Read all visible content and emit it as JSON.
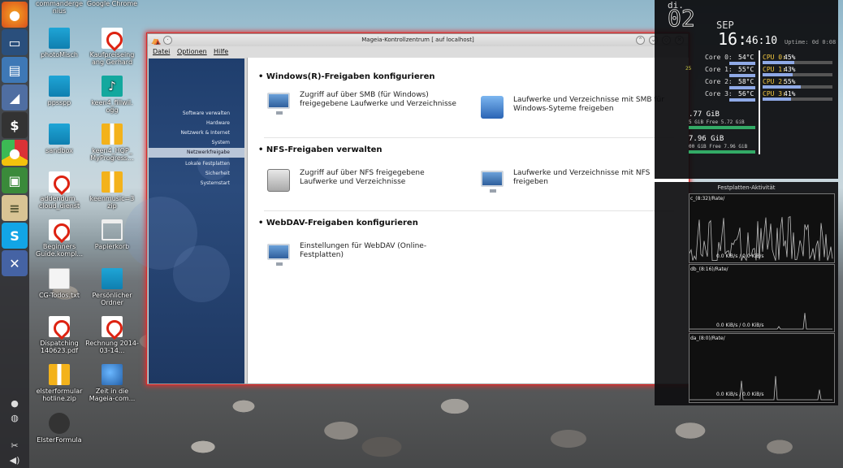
{
  "desktop_icons": [
    {
      "label": "commanderge nius"
    },
    {
      "label": "Google Chrome"
    },
    {
      "label": "photoMisch"
    },
    {
      "label": "Kaufpreiseing ang Gerhard"
    },
    {
      "label": "ppsspp"
    },
    {
      "label": "keen4_fillwil. ogg"
    },
    {
      "label": "sandbox"
    },
    {
      "label": "keen4_HQP_ MyProgress..."
    },
    {
      "label": "addendum_ cloud_dienst"
    },
    {
      "label": "keenmusic=3 zip"
    },
    {
      "label": "Beginners Guide.kompl..."
    },
    {
      "label": "Papierkorb"
    },
    {
      "label": "CG-Todos.txt"
    },
    {
      "label": "Persönlicher Ordner"
    },
    {
      "label": "Dispatching 140623.pdf"
    },
    {
      "label": "Rechnung 2014-03-14..."
    },
    {
      "label": "elsterformular hotline.zip"
    },
    {
      "label": "Zeit in die Mageia-com..."
    },
    {
      "label": "ElsterFormula"
    }
  ],
  "window": {
    "title": "Mageia-Kontrollzentrum  [ auf localhost]",
    "menu": [
      "Datei",
      "Optionen",
      "Hilfe"
    ],
    "sidebar": [
      "Software verwalten",
      "Hardware",
      "Netzwerk & Internet",
      "System",
      "Netzwerkfreigabe",
      "Lokale Festplatten",
      "Sicherheit",
      "Systemstart"
    ],
    "sections": [
      {
        "title": "Windows(R)-Freigaben konfigurieren",
        "items": [
          "Zugriff auf über SMB (für Windows) freigegebene Laufwerke und Verzeichnisse",
          "Laufwerke und Verzeichnisse mit SMB für Windows-Syteme freigeben"
        ]
      },
      {
        "title": "NFS-Freigaben verwalten",
        "items": [
          "Zugriff auf über NFS freigegebene Laufwerke und Verzeichnisse",
          "Laufwerke und Verzeichnisse mit NFS freigeben"
        ]
      },
      {
        "title": "WebDAV-Freigaben konfigurieren",
        "items": [
          "Einstellungen für WebDAV (Online-Festplatten)"
        ]
      }
    ]
  },
  "conky": {
    "day": "di.",
    "date": "02",
    "month": "SEP",
    "time_hm": "16:",
    "time_ms": "46:10",
    "uptime": "Uptime: 0d 0:08",
    "cores": [
      {
        "label": "Core 0:",
        "temp": "54°C"
      },
      {
        "label": "Core 1:",
        "temp": "55°C"
      },
      {
        "label": "Core 2:",
        "temp": "58°C"
      },
      {
        "label": "Core 3:",
        "temp": "56°C"
      }
    ],
    "cpus": [
      {
        "label": "CPU 0:",
        "pct": "45%",
        "value": 0.45
      },
      {
        "label": "CPU 1:",
        "pct": "43%",
        "value": 0.43
      },
      {
        "label": "CPU 2:",
        "pct": "55%",
        "value": 0.55
      },
      {
        "label": "CPU 3:",
        "pct": "41%",
        "value": 0.41
      }
    ],
    "mem_a": ".77 GiB",
    "mem_a2": "5 GiB Free 5.72 GiB",
    "mem_b": "7.96 GiB",
    "mem_b2": "00 GiB Free 7.96 GiB",
    "left_val": "25"
  },
  "hdd": {
    "title": "Festplatten-Aktivität",
    "graphs": [
      {
        "name": "c_(8:32)/Rate/",
        "rate": "0.0 KiB/s / 0.0 KiB/s"
      },
      {
        "name": "db_(8:16)/Rate/",
        "rate": "0.0 KiB/s / 0.0 KiB/s"
      },
      {
        "name": "da_(8:0)/Rate/",
        "rate": "0.0 KiB/s / 0.0 KiB/s"
      }
    ]
  }
}
